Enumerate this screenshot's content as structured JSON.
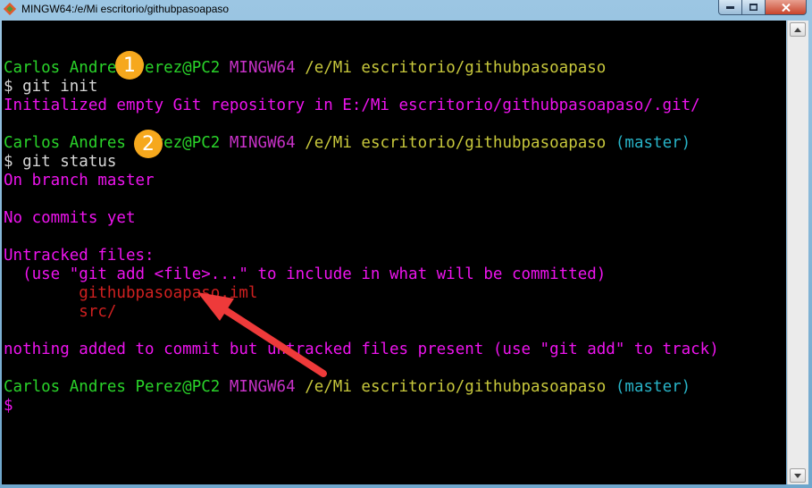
{
  "window": {
    "title": "MINGW64:/e/Mi escritorio/githubpasoapaso",
    "minimize_icon": "minimize-icon",
    "maximize_icon": "maximize-icon",
    "close_icon": "close-icon"
  },
  "terminal": {
    "lines": [
      [],
      [
        {
          "text": "Carlos Andres Perez@PC2",
          "color": "green"
        },
        {
          "text": " ",
          "color": "white"
        },
        {
          "text": "MINGW64",
          "color": "mag"
        },
        {
          "text": " ",
          "color": "white"
        },
        {
          "text": "/e/Mi escritorio/githubpasoapaso",
          "color": "yellow"
        }
      ],
      [
        {
          "text": "$ git init",
          "color": "white"
        }
      ],
      [
        {
          "text": "Initialized empty Git repository in E:/Mi escritorio/githubpasoapaso/.git/",
          "color": "pink"
        }
      ],
      [],
      [
        {
          "text": "Carlos Andres Perez@PC2",
          "color": "green"
        },
        {
          "text": " ",
          "color": "white"
        },
        {
          "text": "MINGW64",
          "color": "mag"
        },
        {
          "text": " ",
          "color": "white"
        },
        {
          "text": "/e/Mi escritorio/githubpasoapaso",
          "color": "yellow"
        },
        {
          "text": " ",
          "color": "white"
        },
        {
          "text": "(master)",
          "color": "cyan"
        }
      ],
      [
        {
          "text": "$ git status",
          "color": "white"
        }
      ],
      [
        {
          "text": "On branch master",
          "color": "pink"
        }
      ],
      [],
      [
        {
          "text": "No commits yet",
          "color": "pink"
        }
      ],
      [],
      [
        {
          "text": "Untracked files:",
          "color": "pink"
        }
      ],
      [
        {
          "text": "  (use \"git add <file>...\" to include in what will be committed)",
          "color": "pink"
        }
      ],
      [
        {
          "text": "        githubpasoapaso.iml",
          "color": "red"
        }
      ],
      [
        {
          "text": "        src/",
          "color": "red"
        }
      ],
      [],
      [
        {
          "text": "nothing added to commit but untracked files present (use \"git add\" to track)",
          "color": "pink"
        }
      ],
      [],
      [
        {
          "text": "Carlos Andres Perez@PC2",
          "color": "green"
        },
        {
          "text": " ",
          "color": "white"
        },
        {
          "text": "MINGW64",
          "color": "mag"
        },
        {
          "text": " ",
          "color": "white"
        },
        {
          "text": "/e/Mi escritorio/githubpasoapaso",
          "color": "yellow"
        },
        {
          "text": " ",
          "color": "white"
        },
        {
          "text": "(master)",
          "color": "cyan"
        }
      ],
      [
        {
          "text": "$",
          "color": "pink"
        }
      ]
    ]
  },
  "annotations": {
    "badge_1": "1",
    "badge_2": "2",
    "badge_color": "#f6a81d",
    "arrow_color": "#ee3a3a"
  },
  "colors": {
    "green": "#2ad42a",
    "mag": "#c832c8",
    "yellow": "#c8c83c",
    "cyan": "#28b4c8",
    "white": "#d6d6d6",
    "pink": "#ee14ee",
    "red": "#d02020",
    "terminal_bg": "#000000"
  }
}
